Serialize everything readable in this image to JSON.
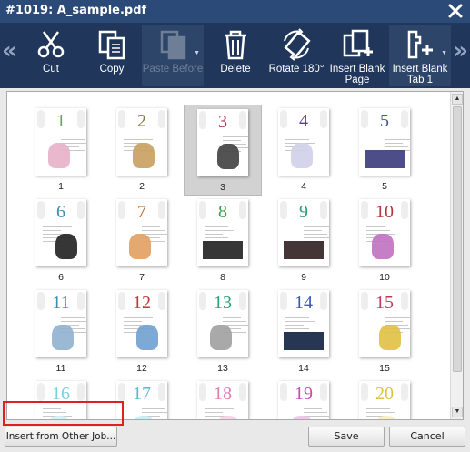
{
  "window": {
    "title": "#1019: A_sample.pdf"
  },
  "toolbar": {
    "prev_arrow": "«",
    "next_arrow": "»",
    "items": [
      {
        "label": "Cut",
        "icon": "scissors-icon",
        "enabled": true
      },
      {
        "label": "Copy",
        "icon": "copy-icon",
        "enabled": true
      },
      {
        "label": "Paste Before",
        "icon": "paste-icon",
        "enabled": false
      },
      {
        "label": "Delete",
        "icon": "trash-icon",
        "enabled": true
      },
      {
        "label": "Rotate 180°",
        "icon": "rotate-icon",
        "enabled": true
      },
      {
        "label": "Insert Blank Page",
        "icon": "insert-blank-page-icon",
        "enabled": true
      },
      {
        "label": "Insert Blank Tab 1",
        "icon": "insert-blank-tab-icon",
        "enabled": true
      }
    ]
  },
  "pages": [
    {
      "number": "1",
      "color": "#6aa84f"
    },
    {
      "number": "2",
      "color": "#8a7a3a"
    },
    {
      "number": "3",
      "color": "#b0355a",
      "selected": true
    },
    {
      "number": "4",
      "color": "#5a3d8a"
    },
    {
      "number": "5",
      "color": "#3d5a9a"
    },
    {
      "number": "6",
      "color": "#3a8fb5"
    },
    {
      "number": "7",
      "color": "#c0622c"
    },
    {
      "number": "8",
      "color": "#3aa24a"
    },
    {
      "number": "9",
      "color": "#2aa07a"
    },
    {
      "number": "10",
      "color": "#b03a3a"
    },
    {
      "number": "11",
      "color": "#3a8fb5"
    },
    {
      "number": "12",
      "color": "#c0393a"
    },
    {
      "number": "13",
      "color": "#2aa07a"
    },
    {
      "number": "14",
      "color": "#3a5ab5"
    },
    {
      "number": "15",
      "color": "#c0395a"
    },
    {
      "number": "16",
      "color": "#7ad0e0"
    },
    {
      "number": "17",
      "color": "#4ac0d0"
    },
    {
      "number": "18",
      "color": "#e07ab0"
    },
    {
      "number": "19",
      "color": "#c84ab0"
    },
    {
      "number": "20",
      "color": "#e0c23a"
    }
  ],
  "buttons": {
    "insert_from_other_job": "Insert from Other Job...",
    "save": "Save",
    "cancel": "Cancel"
  }
}
